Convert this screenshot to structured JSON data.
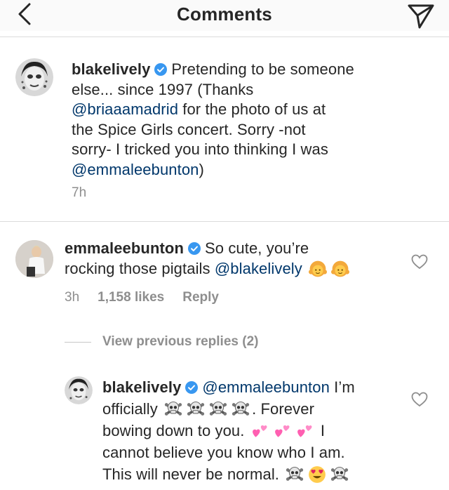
{
  "header": {
    "title": "Comments",
    "back_icon": "chevron-left-icon",
    "send_icon": "paper-plane-icon"
  },
  "caption": {
    "username": "blakelively",
    "text_1": "Pretending to be someone",
    "text_2": "else... since 1997 (Thanks",
    "mention_1": "@briaaamadrid",
    "text_3": " for the photo of us at",
    "text_4": "the Spice Girls concert. Sorry -not",
    "text_5": "sorry- I tricked you into thinking I was",
    "mention_2": "@emmaleebunton",
    "text_6": ")",
    "time": "7h"
  },
  "comment": {
    "username": "emmaleebunton",
    "text_1": "So cute, you’re",
    "text_2": "rocking those pigtails ",
    "mention": "@blakelively",
    "emojis": [
      "girl-with-pigtails-emoji",
      "girl-with-pigtails-emoji"
    ],
    "time": "3h",
    "likes": "1,158 likes",
    "reply": "Reply",
    "view_replies": "View previous replies (2)"
  },
  "reply": {
    "username": "blakelively",
    "mention": "@emmaleebunton",
    "text_1": " I’m",
    "text_2": "officially",
    "text_3": ". Forever",
    "text_4": "bowing down to you.",
    "text_5": "I",
    "text_6": "cannot believe you know who I am.",
    "text_7": "This will never be normal.",
    "emojis_line2": [
      "skull-and-crossbones-emoji",
      "skull-and-crossbones-emoji",
      "skull-and-crossbones-emoji",
      "skull-and-crossbones-emoji"
    ],
    "emojis_line3": [
      "two-hearts-emoji",
      "two-hearts-emoji",
      "two-hearts-emoji"
    ],
    "emojis_line5": [
      "skull-and-crossbones-emoji",
      "heart-eyes-emoji",
      "skull-and-crossbones-emoji"
    ]
  },
  "colors": {
    "text": "#262626",
    "mention": "#00376b",
    "meta": "#8e8e8e",
    "verified": "#3897f0",
    "divider": "#dbdbdb"
  }
}
